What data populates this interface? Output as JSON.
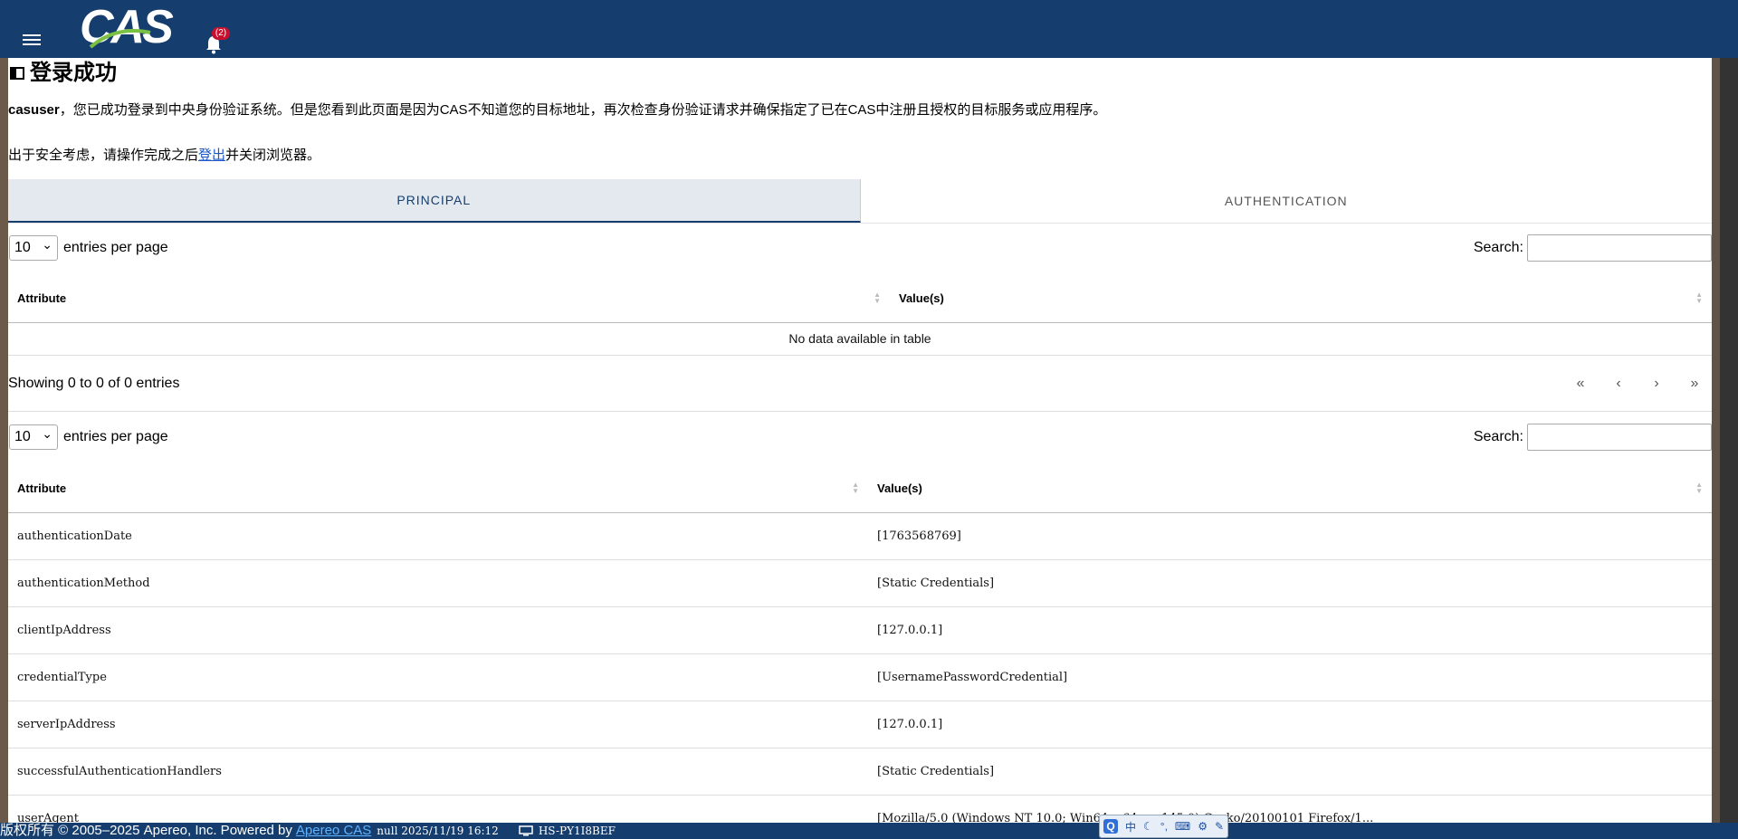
{
  "header": {
    "logo_text": "CAS",
    "notification_count": "(2)"
  },
  "page": {
    "title": "登录成功",
    "user": "casuser",
    "message": "，您已成功登录到中央身份验证系统。但是您看到此页面是因为CAS不知道您的目标地址，再次检查身份验证请求并确保指定了已在CAS中注册且授权的目标服务或应用程序。",
    "security_prefix": "出于安全考虑，请操作完成之后",
    "logout_link": "登出",
    "security_suffix": "并关闭浏览器。"
  },
  "tabs": [
    {
      "label": "PRINCIPAL",
      "active": true
    },
    {
      "label": "AUTHENTICATION",
      "active": false
    }
  ],
  "principal_table": {
    "page_length": "10",
    "entries_label": "entries per page",
    "search_label": "Search:",
    "columns": [
      "Attribute",
      "Value(s)"
    ],
    "empty_message": "No data available in table",
    "info": "Showing 0 to 0 of 0 entries",
    "pager": [
      "«",
      "‹",
      "›",
      "»"
    ]
  },
  "auth_table": {
    "page_length": "10",
    "entries_label": "entries per page",
    "search_label": "Search:",
    "columns": [
      "Attribute",
      "Value(s)"
    ],
    "rows": [
      [
        "authenticationDate",
        "[1763568769]"
      ],
      [
        "authenticationMethod",
        "[Static Credentials]"
      ],
      [
        "clientIpAddress",
        "[127.0.0.1]"
      ],
      [
        "credentialType",
        "[UsernamePasswordCredential]"
      ],
      [
        "serverIpAddress",
        "[127.0.0.1]"
      ],
      [
        "successfulAuthenticationHandlers",
        "[Static Credentials]"
      ],
      [
        "userAgent",
        "[Mozilla/5.0 (Windows NT 10.0; Win64; x64; rv:145.0) Gecko/20100101 Firefox/1..."
      ]
    ]
  },
  "footer": {
    "copyright": "版权所有 © 2005–2025 Apereo, Inc.  Powered by",
    "link": "Apereo CAS",
    "info": "null 2025/11/19 16:12",
    "host": "HS-PY1I8BEF"
  },
  "ime": {
    "q": "Q",
    "lang": "中"
  },
  "colors": {
    "header_bg": "#153e6f",
    "tab_active_bg": "#e4e9f0",
    "link": "#1a56c6"
  }
}
